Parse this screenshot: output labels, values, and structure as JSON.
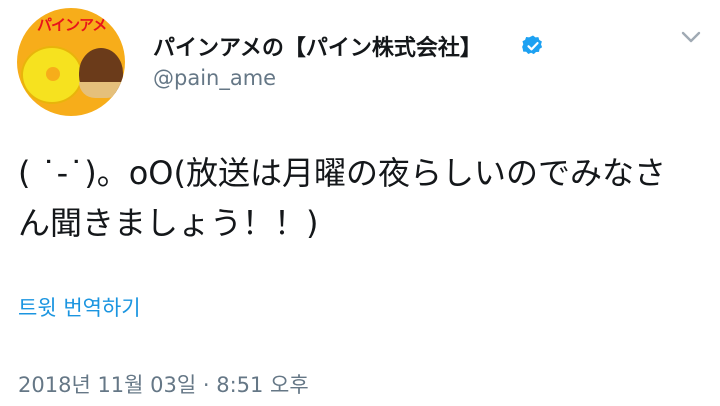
{
  "user": {
    "avatar_logo_text": "パインアメ",
    "display_name": "パインアメの【パイン株式会社】",
    "handle": "@pain_ame",
    "verified": true
  },
  "tweet": {
    "text_line1": "( ˙-˙)。oO(放送は月曜の夜らしいのでみなさ",
    "text_line2": "ん聞きましょう！！)",
    "translate_label": "트윗 번역하기",
    "timestamp": "2018년 11월 03일 · 8:51 오후"
  },
  "icons": {
    "verified": "verified-badge-icon",
    "menu": "chevron-down-icon"
  },
  "colors": {
    "link": "#1b95e0",
    "secondary_text": "#657786",
    "verified": "#1da1f2"
  }
}
